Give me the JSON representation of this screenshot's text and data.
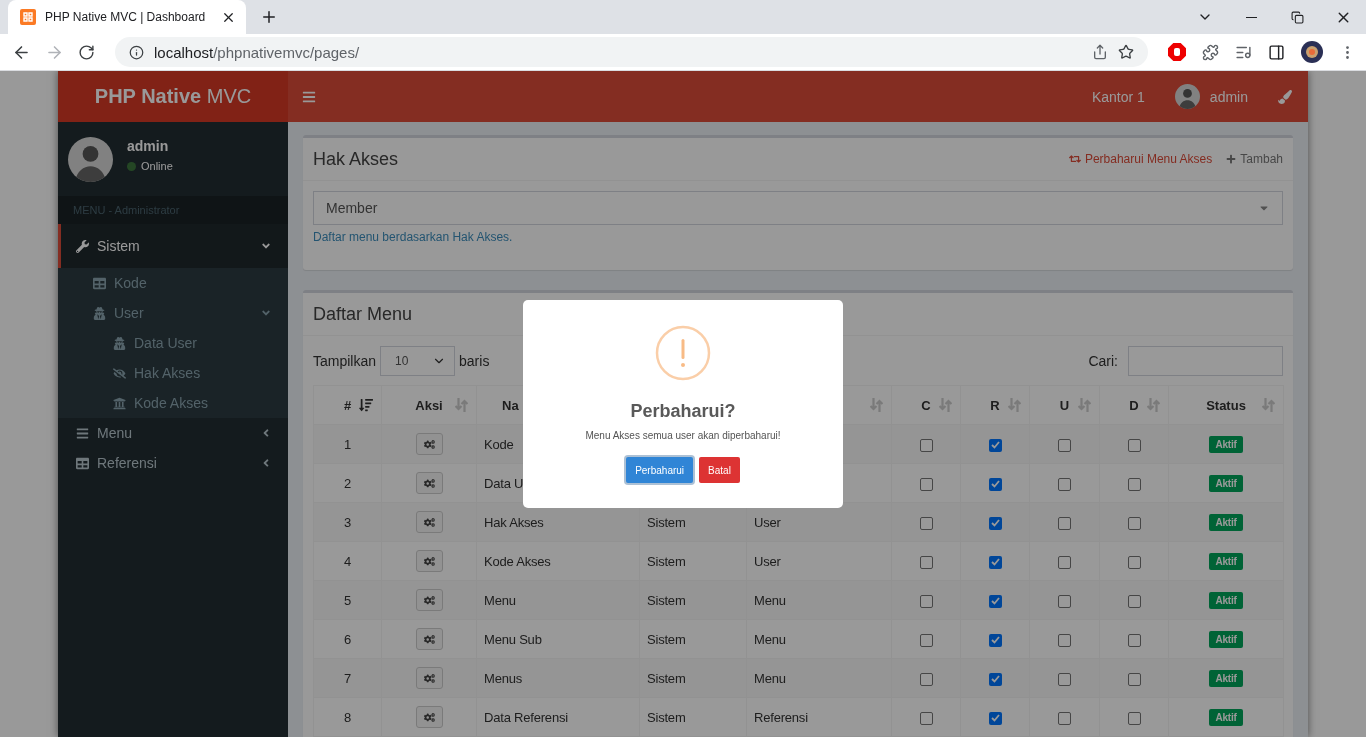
{
  "browser": {
    "tab": {
      "title": "PHP Native MVC | Dashboard"
    },
    "url": {
      "host": "localhost",
      "path": "/phpnativemvc/pages/"
    }
  },
  "header": {
    "brand": "**PHP Native** MVC",
    "office": "Kantor 1",
    "user": "admin"
  },
  "sidebar": {
    "user": {
      "name": "admin",
      "status": "Online"
    },
    "section": "MENU - Administrator",
    "items": [
      {
        "label": "Sistem",
        "active": true,
        "expanded": true,
        "children": [
          {
            "label": "Kode"
          },
          {
            "label": "User",
            "expanded": true,
            "children": [
              {
                "label": "Data User"
              },
              {
                "label": "Hak Akses"
              },
              {
                "label": "Kode Akses"
              }
            ]
          }
        ]
      },
      {
        "label": "Menu",
        "active": false,
        "expanded": false
      },
      {
        "label": "Referensi",
        "active": false,
        "expanded": false
      }
    ]
  },
  "access_box": {
    "title": "Hak Akses",
    "actions": [
      {
        "kind": "refresh",
        "label": "Perbaharui Menu Akses"
      },
      {
        "kind": "add",
        "label": "Tambah"
      }
    ],
    "role_select": {
      "value": "Member"
    },
    "help": "Daftar menu berdasarkan Hak Akses."
  },
  "menu_box": {
    "title": "Daftar Menu",
    "length": {
      "before": "Tampilkan",
      "value": "10",
      "after": "baris"
    },
    "search": {
      "label": "Cari:"
    },
    "table": {
      "columns": [
        {
          "label": "#",
          "sorted": true
        },
        {
          "label": "Aksi",
          "sorted": false
        },
        {
          "label": "Na"
        },
        {},
        {
          "sorted": false
        },
        {
          "label": "C",
          "sorted": false
        },
        {
          "label": "R",
          "sorted": false
        },
        {
          "label": "U",
          "sorted": false
        },
        {
          "label": "D",
          "sorted": false
        },
        {
          "label": "Status",
          "sorted": false
        }
      ],
      "rows": [
        {
          "no": "1",
          "name": "Kode",
          "c": false,
          "r": true,
          "u": false,
          "d": false,
          "status": "Aktif"
        },
        {
          "no": "2",
          "name": "Data U",
          "c": false,
          "r": true,
          "u": false,
          "d": false,
          "status": "Aktif"
        },
        {
          "no": "3",
          "name": "Hak Akses",
          "column_4": "Sistem",
          "column_5": "User",
          "c": false,
          "r": true,
          "u": false,
          "d": false,
          "status": "Aktif"
        },
        {
          "no": "4",
          "name": "Kode Akses",
          "column_4": "Sistem",
          "column_5": "User",
          "c": false,
          "r": true,
          "u": false,
          "d": false,
          "status": "Aktif"
        },
        {
          "no": "5",
          "name": "Menu",
          "column_4": "Sistem",
          "column_5": "Menu",
          "c": false,
          "r": true,
          "u": false,
          "d": false,
          "status": "Aktif"
        },
        {
          "no": "6",
          "name": "Menu Sub",
          "column_4": "Sistem",
          "column_5": "Menu",
          "c": false,
          "r": true,
          "u": false,
          "d": false,
          "status": "Aktif"
        },
        {
          "no": "7",
          "name": "Menus",
          "column_4": "Sistem",
          "column_5": "Menu",
          "c": false,
          "r": true,
          "u": false,
          "d": false,
          "status": "Aktif"
        },
        {
          "no": "8",
          "name": "Data Referensi",
          "column_4": "Sistem",
          "column_5": "Referensi",
          "c": false,
          "r": true,
          "u": false,
          "d": false,
          "status": "Aktif"
        }
      ]
    }
  },
  "dialog": {
    "title": "Perbaharui?",
    "text": "Menu Akses semua user akan diperbaharui!",
    "buttons": [
      {
        "kind": "confirm",
        "label": "Perbaharui"
      },
      {
        "kind": "cancel",
        "label": "Batal"
      }
    ]
  }
}
